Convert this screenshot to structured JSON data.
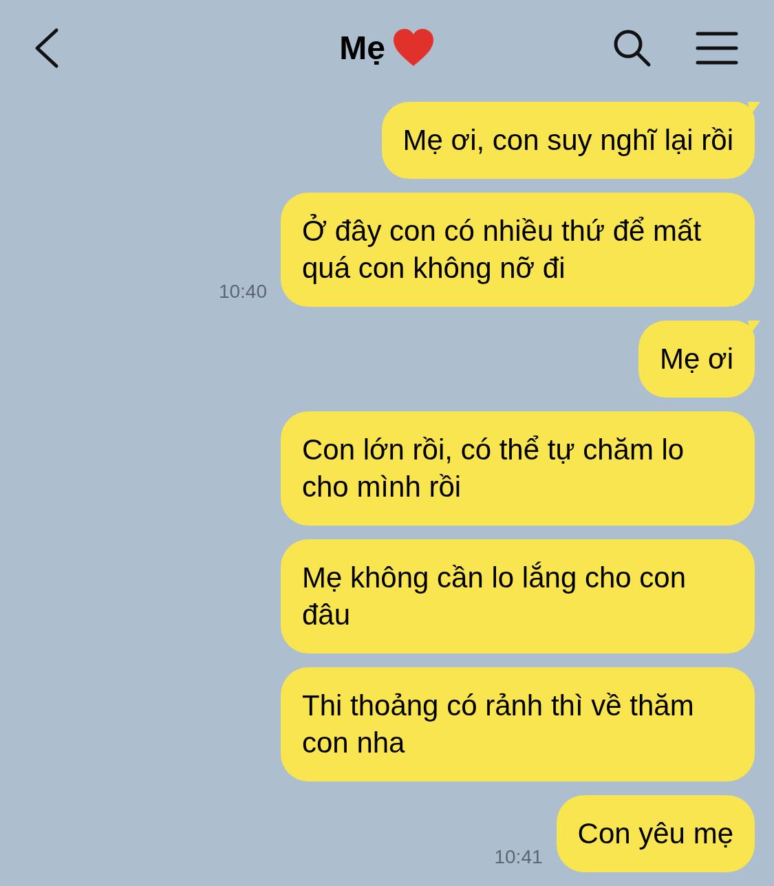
{
  "header": {
    "title": "Mẹ"
  },
  "messages": [
    {
      "text": "Mẹ ơi, con suy nghĩ lại rồi",
      "tail": true
    },
    {
      "text": "Ở đây con có nhiều thứ để mất quá con không nỡ đi",
      "tail": false,
      "time": "10:40"
    },
    {
      "text": "Mẹ ơi",
      "tail": true
    },
    {
      "text": "Con lớn rồi, có thể tự chăm lo cho mình rồi",
      "tail": false
    },
    {
      "text": "Mẹ không cần lo lắng cho con đâu",
      "tail": false
    },
    {
      "text": "Thi thoảng có rảnh thì về thăm con nha",
      "tail": false
    },
    {
      "text": "Con yêu mẹ",
      "tail": false,
      "time": "10:41"
    }
  ]
}
